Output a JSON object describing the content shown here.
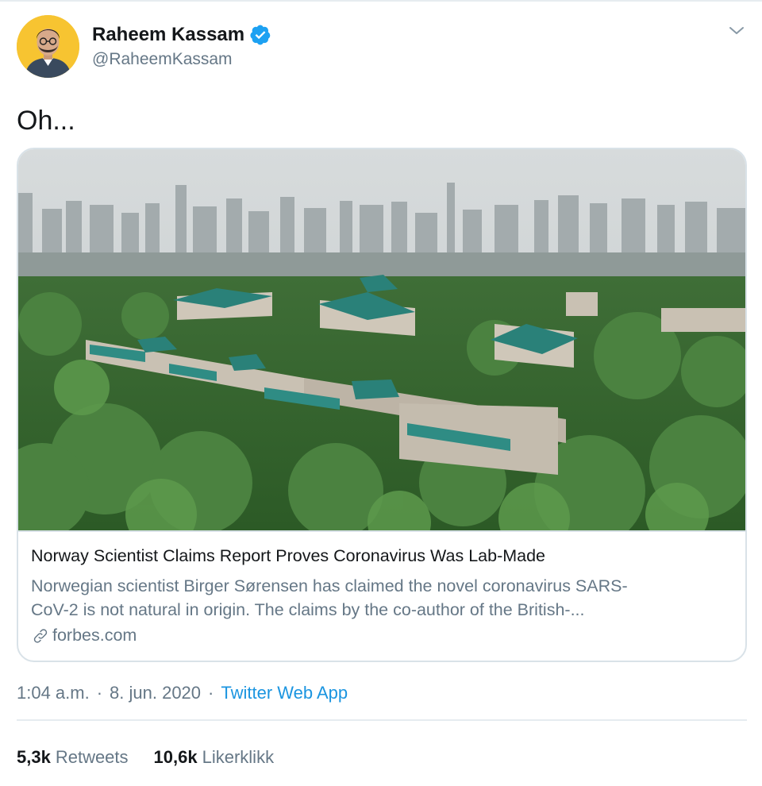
{
  "tweet": {
    "author": {
      "display_name": "Raheem Kassam",
      "handle": "@RaheemKassam",
      "verified": true,
      "avatar_bg": "#f7c431"
    },
    "text": "Oh...",
    "card": {
      "title": "Norway Scientist Claims Report Proves Coronavirus Was Lab-Made",
      "description_line1": "Norwegian scientist Birger Sørensen has claimed the novel coronavirus SARS-",
      "description_line2": "CoV-2 is not natural in origin. The claims by the co-author of the British-...",
      "domain": "forbes.com",
      "link_icon": "link-icon",
      "image": "aerial-campus-photo"
    },
    "meta": {
      "time": "1:04 a.m.",
      "separator": "·",
      "date": "8. jun. 2020",
      "source": "Twitter Web App"
    },
    "stats": {
      "retweets_count": "5,3k",
      "retweets_label": "Retweets",
      "likes_count": "10,6k",
      "likes_label": "Likerklikk"
    },
    "colors": {
      "accent": "#1b95e0",
      "verified": "#1da1f2",
      "secondary_text": "#657786",
      "border": "#d9e2e8"
    }
  }
}
